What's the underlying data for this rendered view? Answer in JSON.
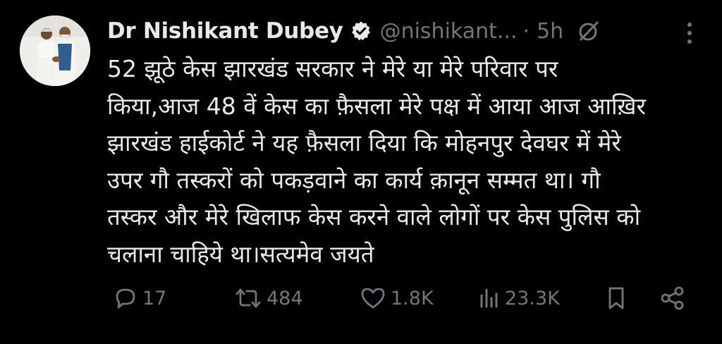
{
  "tweet": {
    "author": {
      "display_name": "Dr Nishikant Dubey",
      "handle": "@nishikant...",
      "separator": "·",
      "time": "5h",
      "avatar": "avatar-photo-two-men"
    },
    "text": "52 झूठे केस झारखंड सरकार ने मेरे या मेरे परिवार पर\nकिया,आज 48 वें केस का फ़ैसला मेरे पक्ष में आया आज आख़िर\nझारखंड हाईकोर्ट ने यह फ़ैसला दिया कि मोहनपुर देवघर में मेरे\nउपर गौ तस्करों को पकड़वाने का कार्य क़ानून सम्मत था। गौ\nतस्कर और मेरे खिलाफ केस करने वाले लोगों पर केस पुलिस को\nचलाना चाहिये था।सत्यमेव जयते",
    "actions": {
      "replies": "17",
      "reposts": "484",
      "likes": "1.8K",
      "views": "23.3K"
    },
    "icons": {
      "verified": "verified-badge-icon",
      "grok": "grok-icon",
      "more": "more-vertical-icon",
      "reply": "reply-icon",
      "repost": "repost-icon",
      "like": "heart-icon",
      "views": "views-icon",
      "bookmark": "bookmark-icon",
      "share": "share-icon"
    },
    "colors": {
      "background": "#000000",
      "text": "#e7e9ea",
      "muted": "#71767b"
    }
  }
}
